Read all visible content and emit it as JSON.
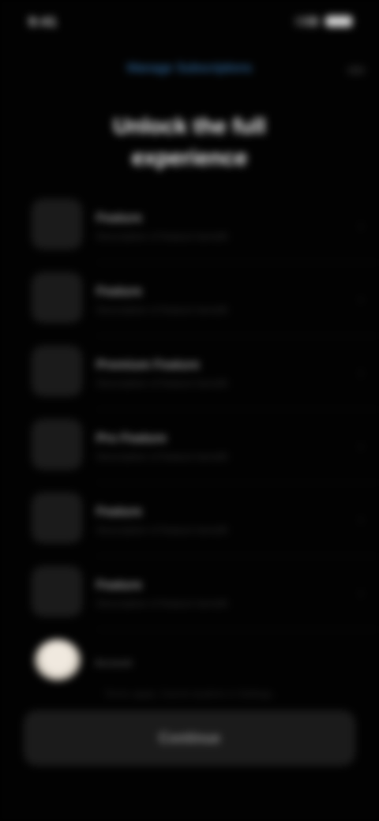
{
  "status_bar": {
    "time": "9:41"
  },
  "header": {
    "link": "Manage Subscriptions",
    "title": "Unlock the full experience"
  },
  "features": [
    {
      "title": "Feature",
      "subtitle": "Description of feature benefit",
      "icon": "app-icon"
    },
    {
      "title": "Feature",
      "subtitle": "Description of feature benefit",
      "icon": "app-icon"
    },
    {
      "title": "Premium Feature",
      "subtitle": "Description of feature benefit",
      "icon": "app-icon"
    },
    {
      "title": "Pro Feature",
      "subtitle": "Description of feature benefit",
      "icon": "app-icon"
    },
    {
      "title": "Feature",
      "subtitle": "Description of feature benefit",
      "icon": "app-icon"
    },
    {
      "title": "Feature",
      "subtitle": "Description of feature benefit",
      "icon": "app-icon"
    }
  ],
  "profile": {
    "label": "Account"
  },
  "footer": {
    "note": "Terms apply. Cancel anytime in Settings.",
    "cta": "Continue"
  }
}
